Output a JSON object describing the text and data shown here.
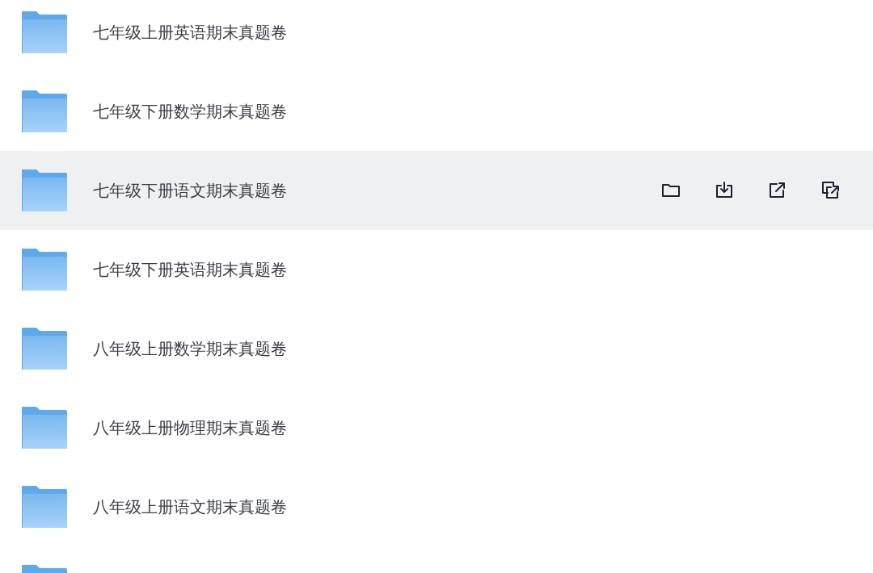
{
  "files": [
    {
      "name": "七年级上册英语期末真题卷",
      "hovered": false
    },
    {
      "name": "七年级下册数学期末真题卷",
      "hovered": false
    },
    {
      "name": "七年级下册语文期末真题卷",
      "hovered": true
    },
    {
      "name": "七年级下册英语期末真题卷",
      "hovered": false
    },
    {
      "name": "八年级上册数学期末真题卷",
      "hovered": false
    },
    {
      "name": "八年级上册物理期末真题卷",
      "hovered": false
    },
    {
      "name": "八年级上册语文期末真题卷",
      "hovered": false
    },
    {
      "hovered": false
    }
  ]
}
